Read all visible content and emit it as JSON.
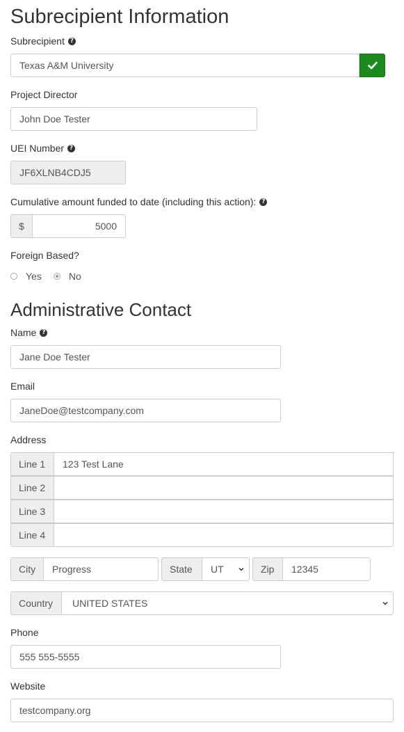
{
  "subrecipient_section": {
    "title": "Subrecipient Information",
    "subrecipient_label": "Subrecipient",
    "subrecipient_value": "Texas A&M University",
    "project_director_label": "Project Director",
    "project_director_value": "John Doe Tester",
    "uei_label": "UEI Number",
    "uei_value": "JF6XLNB4CDJ5",
    "cumulative_label": "Cumulative amount funded to date (including this action):",
    "currency_symbol": "$",
    "cumulative_value": "5000",
    "foreign_label": "Foreign Based?",
    "foreign_options": [
      {
        "label": "Yes",
        "selected": false
      },
      {
        "label": "No",
        "selected": true
      }
    ]
  },
  "admin_section": {
    "title": "Administrative Contact",
    "name_label": "Name",
    "name_value": "Jane Doe Tester",
    "email_label": "Email",
    "email_value": "JaneDoe@testcompany.com",
    "address_label": "Address",
    "address_lines": [
      {
        "label": "Line 1",
        "value": "123 Test Lane"
      },
      {
        "label": "Line 2",
        "value": ""
      },
      {
        "label": "Line 3",
        "value": ""
      },
      {
        "label": "Line 4",
        "value": ""
      }
    ],
    "city_label": "City",
    "city_value": "Progress",
    "state_label": "State",
    "state_value": "UT",
    "zip_label": "Zip",
    "zip_value": "12345",
    "country_label": "Country",
    "country_value": "UNITED STATES",
    "phone_label": "Phone",
    "phone_value": "555 555-5555",
    "website_label": "Website",
    "website_value": "testcompany.org"
  },
  "colors": {
    "accent_green": "#1c8a1c",
    "addon_bg": "#eeeeee",
    "border": "#cccccc"
  },
  "icons": {
    "help": "question-circle-icon",
    "verify": "check-icon",
    "dropdown": "chevron-down-icon"
  }
}
